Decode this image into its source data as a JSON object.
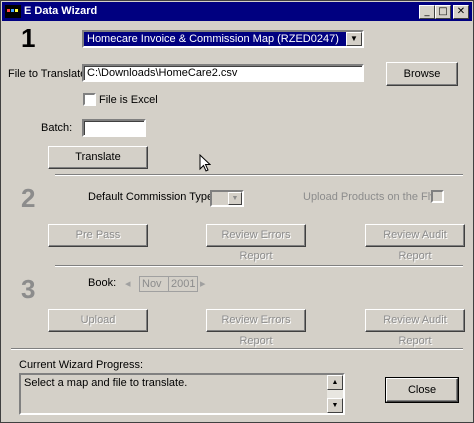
{
  "window": {
    "title": "E Data Wizard",
    "controls": {
      "minimize": "_",
      "maximize": "□",
      "close": "✕"
    }
  },
  "step1": {
    "number": "1",
    "map_select": "Homecare Invoice & Commission Map (RZED0247)",
    "file_label": "File to Translate:",
    "file_value": "C:\\Downloads\\HomeCare2.csv",
    "browse_label": "Browse",
    "excel_label": "File is Excel",
    "batch_label": "Batch:",
    "batch_value": "",
    "translate_label": "Translate"
  },
  "step2": {
    "number": "2",
    "commission_label": "Default Commission Type:",
    "upload_products_label": "Upload Products on the Fly:",
    "prepass_label": "Pre Pass",
    "errors_label": "Review Errors Report",
    "audit_label": "Review Audit Report"
  },
  "step3": {
    "number": "3",
    "book_label": "Book:",
    "book_month": "Nov",
    "book_year": "2001",
    "upload_label": "Upload",
    "errors_label": "Review Errors Report",
    "audit_label": "Review Audit Report"
  },
  "progress": {
    "label": "Current Wizard Progress:",
    "text": "Select a map and file to translate.",
    "close_label": "Close"
  },
  "colors": {
    "titlebar": "#000080",
    "face": "#d4d0c8",
    "disabled_text": "#8c8c8c"
  }
}
